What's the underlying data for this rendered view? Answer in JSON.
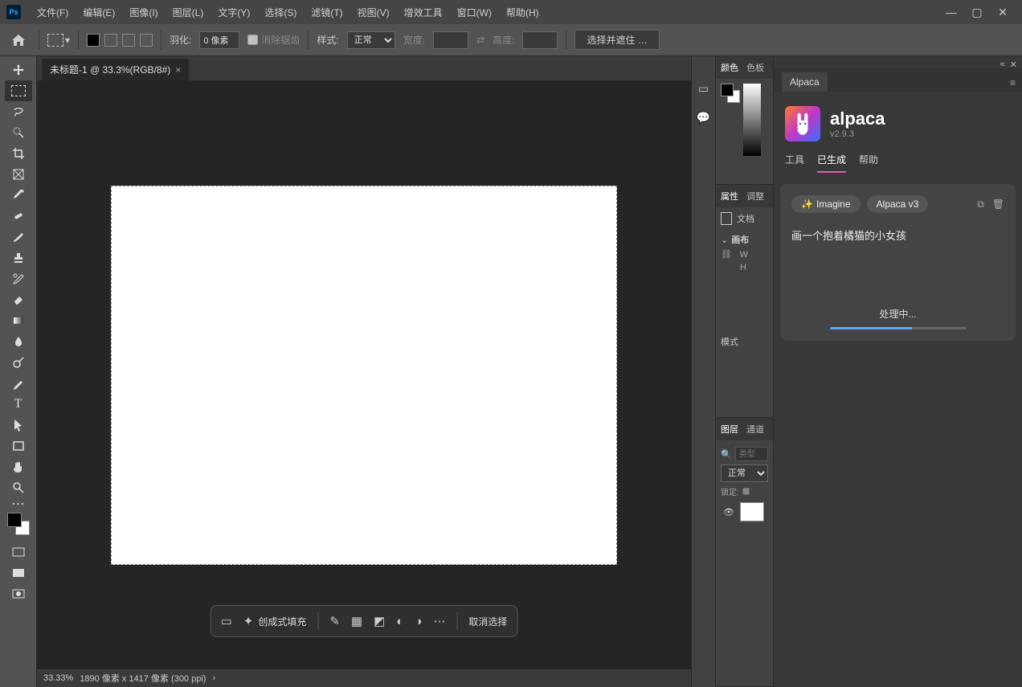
{
  "menubar": {
    "items": [
      "文件(F)",
      "编辑(E)",
      "图像(I)",
      "图层(L)",
      "文字(Y)",
      "选择(S)",
      "滤镜(T)",
      "视图(V)",
      "增效工具",
      "窗口(W)",
      "帮助(H)"
    ]
  },
  "options": {
    "feather_label": "羽化:",
    "feather_value": "0 像素",
    "antialias": "消除锯齿",
    "style_label": "样式:",
    "style_value": "正常",
    "width_label": "宽度:",
    "height_label": "高度:",
    "select_mask": "选择并遮住 …"
  },
  "doc": {
    "tab_title": "未标题-1 @ 33.3%(RGB/8#)"
  },
  "context_bar": {
    "gen_fill": "创成式填充",
    "deselect": "取消选择"
  },
  "status": {
    "zoom": "33.33%",
    "info": "1890 像素 x 1417 像素 (300 ppi)"
  },
  "panels": {
    "color_tab": "颜色",
    "swatch_tab": "色板",
    "props_tab": "属性",
    "adjust_tab": "调整",
    "doc_label": "文档",
    "canvas_label": "画布",
    "w_label": "W",
    "h_label": "H",
    "mode_label": "模式",
    "layers_tab": "图层",
    "channels_tab": "通道",
    "layer_search_placeholder": "类型",
    "blend_mode": "正常",
    "lock_label": "锁定:"
  },
  "alpaca": {
    "panel_title": "Alpaca",
    "title": "alpaca",
    "version": "v2.9.3",
    "subtabs": {
      "tools": "工具",
      "generated": "已生成",
      "help": "帮助"
    },
    "chip_imagine": "Imagine",
    "chip_model": "Alpaca v3",
    "prompt": "画一个抱着橘猫的小女孩",
    "progress_text": "处理中..."
  }
}
